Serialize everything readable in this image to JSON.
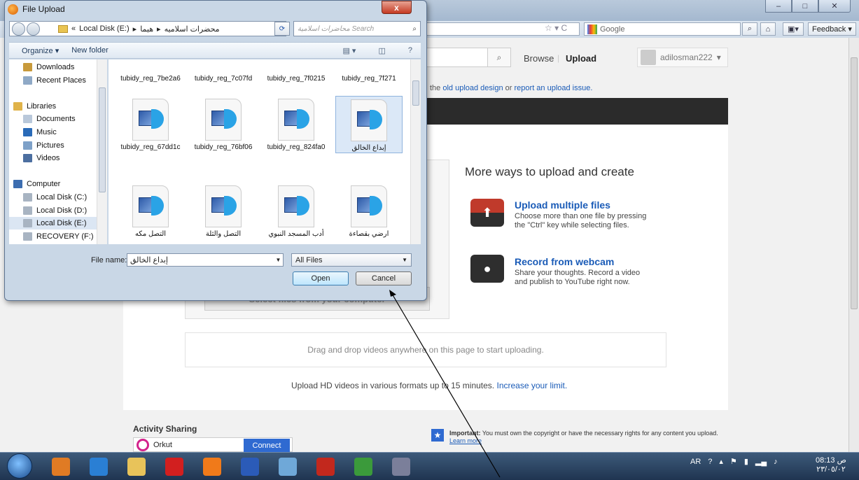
{
  "dialog": {
    "title": "File Upload",
    "close_label": "x",
    "path": [
      "«",
      "Local Disk (E:)",
      "▸",
      "هيما",
      "▸",
      "محضرات اسلاميه"
    ],
    "search_placeholder": "محاضرات اسلامية Search",
    "toolbar": {
      "organize": "Organize ▾",
      "new_folder": "New folder"
    },
    "nav_items": [
      {
        "label": "Downloads",
        "color": "#c89a3b"
      },
      {
        "label": "Recent Places",
        "color": "#8fa9c6"
      },
      {
        "label": "",
        "color": ""
      },
      {
        "label": "Libraries",
        "color": "#e0b34a"
      },
      {
        "label": "Documents",
        "color": "#b9c8da"
      },
      {
        "label": "Music",
        "color": "#2a6bb8"
      },
      {
        "label": "Pictures",
        "color": "#7ea1c8"
      },
      {
        "label": "Videos",
        "color": "#4c6fa0"
      },
      {
        "label": "",
        "color": ""
      },
      {
        "label": "Computer",
        "color": "#3c6db0"
      },
      {
        "label": "Local Disk (C:)",
        "color": "#a8b4c2"
      },
      {
        "label": "Local Disk (D:)",
        "color": "#a8b4c2"
      },
      {
        "label": "Local Disk (E:)",
        "color": "#a8b4c2"
      },
      {
        "label": "RECOVERY (F:)",
        "color": "#a8b4c2"
      }
    ],
    "files_row1": [
      "tubidy_reg_7be2a6",
      "tubidy_reg_7c07fd",
      "tubidy_reg_7f0215",
      "tubidy_reg_7f271"
    ],
    "files_row2": [
      "tubidy_reg_67dd1c",
      "tubidy_reg_76bf06",
      "tubidy_reg_824fa0",
      "إبداع الخالق"
    ],
    "files_row3": [
      "التصل مكه",
      "التصل والثلة",
      "أدب المسجد النبوي",
      "ارضي بقصاءة"
    ],
    "file_name_label": "File name:",
    "file_name_value": "إبداع الخالق",
    "filter": "All Files",
    "open": "Open",
    "cancel": "Cancel"
  },
  "browser": {
    "search_engine": "Google",
    "feedback": "Feedback ▾"
  },
  "youtube": {
    "browse": "Browse",
    "upload": "Upload",
    "username": "adilosman222",
    "old_text_pre": "the",
    "old_upload_link": "old upload design",
    "old_or": "or",
    "report_link": "report an upload issue.",
    "select_files": "Select files from your computer",
    "more_ways": "More ways to upload and create",
    "multi_title": "Upload multiple files",
    "multi_desc": "Choose more than one file by pressing the \"Ctrl\" key while selecting files.",
    "cam_title": "Record from webcam",
    "cam_desc": "Share your thoughts. Record a video and publish to YouTube right now.",
    "drop_text": "Drag and drop videos anywhere on this page to start uploading.",
    "hd_text": "Upload HD videos in various formats up to 15 minutes.",
    "increase_link": "Increase your limit.",
    "activity_sharing": "Activity Sharing",
    "orkut": "Orkut",
    "connect": "Connect",
    "important_bold": "Important:",
    "important_text": "You must own the copyright or have the necessary rights for any content you upload.",
    "learn_more": "Learn more"
  },
  "taskbar": {
    "lang": "AR",
    "time": "08:13 ص",
    "date": "٢٣/٠٥/٠٢",
    "apps": [
      "Media Center",
      "Internet Explorer",
      "Explorer",
      "Opera",
      "Firefox",
      "Word",
      "Paint",
      "Acrobat",
      "Chrome",
      "Zain"
    ],
    "app_colors": [
      "#e07b24",
      "#2a7fd4",
      "#e8c35a",
      "#d21f1f",
      "#f07a1a",
      "#2b5bb8",
      "#6fa8d8",
      "#c2281d",
      "#3b9a3b",
      "#7b7f9a"
    ]
  }
}
